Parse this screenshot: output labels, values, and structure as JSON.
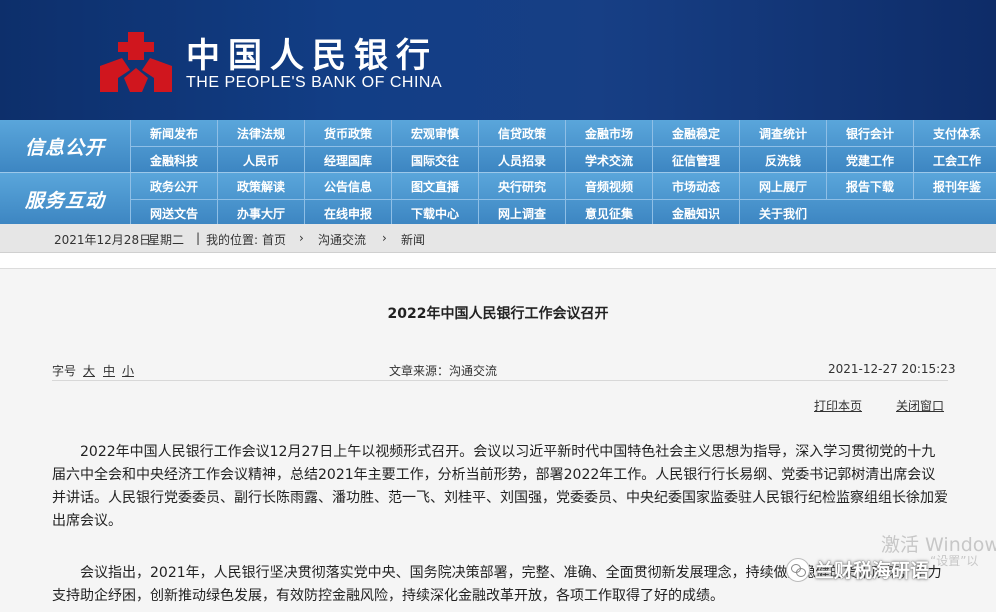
{
  "header": {
    "logo_cn": "中国人民银行",
    "logo_en": "THE PEOPLE'S BANK OF CHINA",
    "brand_red": "#d0161e"
  },
  "nav": {
    "info_label": "信息公开",
    "info_rows": [
      [
        "新闻发布",
        "法律法规",
        "货币政策",
        "宏观审慎",
        "信贷政策",
        "金融市场",
        "金融稳定",
        "调查统计",
        "银行会计",
        "支付体系"
      ],
      [
        "金融科技",
        "人民币",
        "经理国库",
        "国际交往",
        "人员招录",
        "学术交流",
        "征信管理",
        "反洗钱",
        "党建工作",
        "工会工作"
      ]
    ],
    "service_label": "服务互动",
    "service_rows": [
      [
        "政务公开",
        "政策解读",
        "公告信息",
        "图文直播",
        "央行研究",
        "音频视频",
        "市场动态",
        "网上展厅",
        "报告下载",
        "报刊年鉴"
      ],
      [
        "网送文告",
        "办事大厅",
        "在线申报",
        "下载中心",
        "网上调查",
        "意见征集",
        "金融知识",
        "关于我们"
      ]
    ]
  },
  "breadcrumb": {
    "date": "2021年12月28日",
    "weekday": "星期二",
    "sep": "|",
    "location_label": "我的位置:",
    "items": [
      "首页",
      "沟通交流",
      "新闻"
    ],
    "arrow": "›"
  },
  "article": {
    "title": "2022年中国人民银行工作会议召开",
    "font_label": "字号",
    "font_large": "大",
    "font_medium": "中",
    "font_small": "小",
    "source": "文章来源：沟通交流",
    "datetime": "2021-12-27  20:15:23",
    "print_label": "打印本页",
    "close_label": "关闭窗口",
    "para1": "2022年中国人民银行工作会议12月27日上午以视频形式召开。会议以习近平新时代中国特色社会主义思想为指导，深入学习贯彻党的十九届六中全会和中央经济工作会议精神，总结2021年主要工作，分析当前形势，部署2022年工作。人民银行行长易纲、党委书记郭树清出席会议并讲话。人民银行党委委员、副行长陈雨露、潘功胜、范一飞、刘桂平、刘国强，党委委员、中央纪委国家监委驻人民银行纪检监察组组长徐加爱出席会议。",
    "para2": "会议指出，2021年，人民银行坚决贯彻落实党中央、国务院决策部署，完整、准确、全面贯彻新发展理念，持续做好稳健的货币政策，全力支持助企纾困，创新推动绿色发展，有效防控金融风险，持续深化金融改革开放，各项工作取得了好的成绩。"
  },
  "overlay": {
    "activate": "激活 Windows",
    "activate_sub": "“设置”以",
    "wechat_name": "兰财税海研语"
  }
}
